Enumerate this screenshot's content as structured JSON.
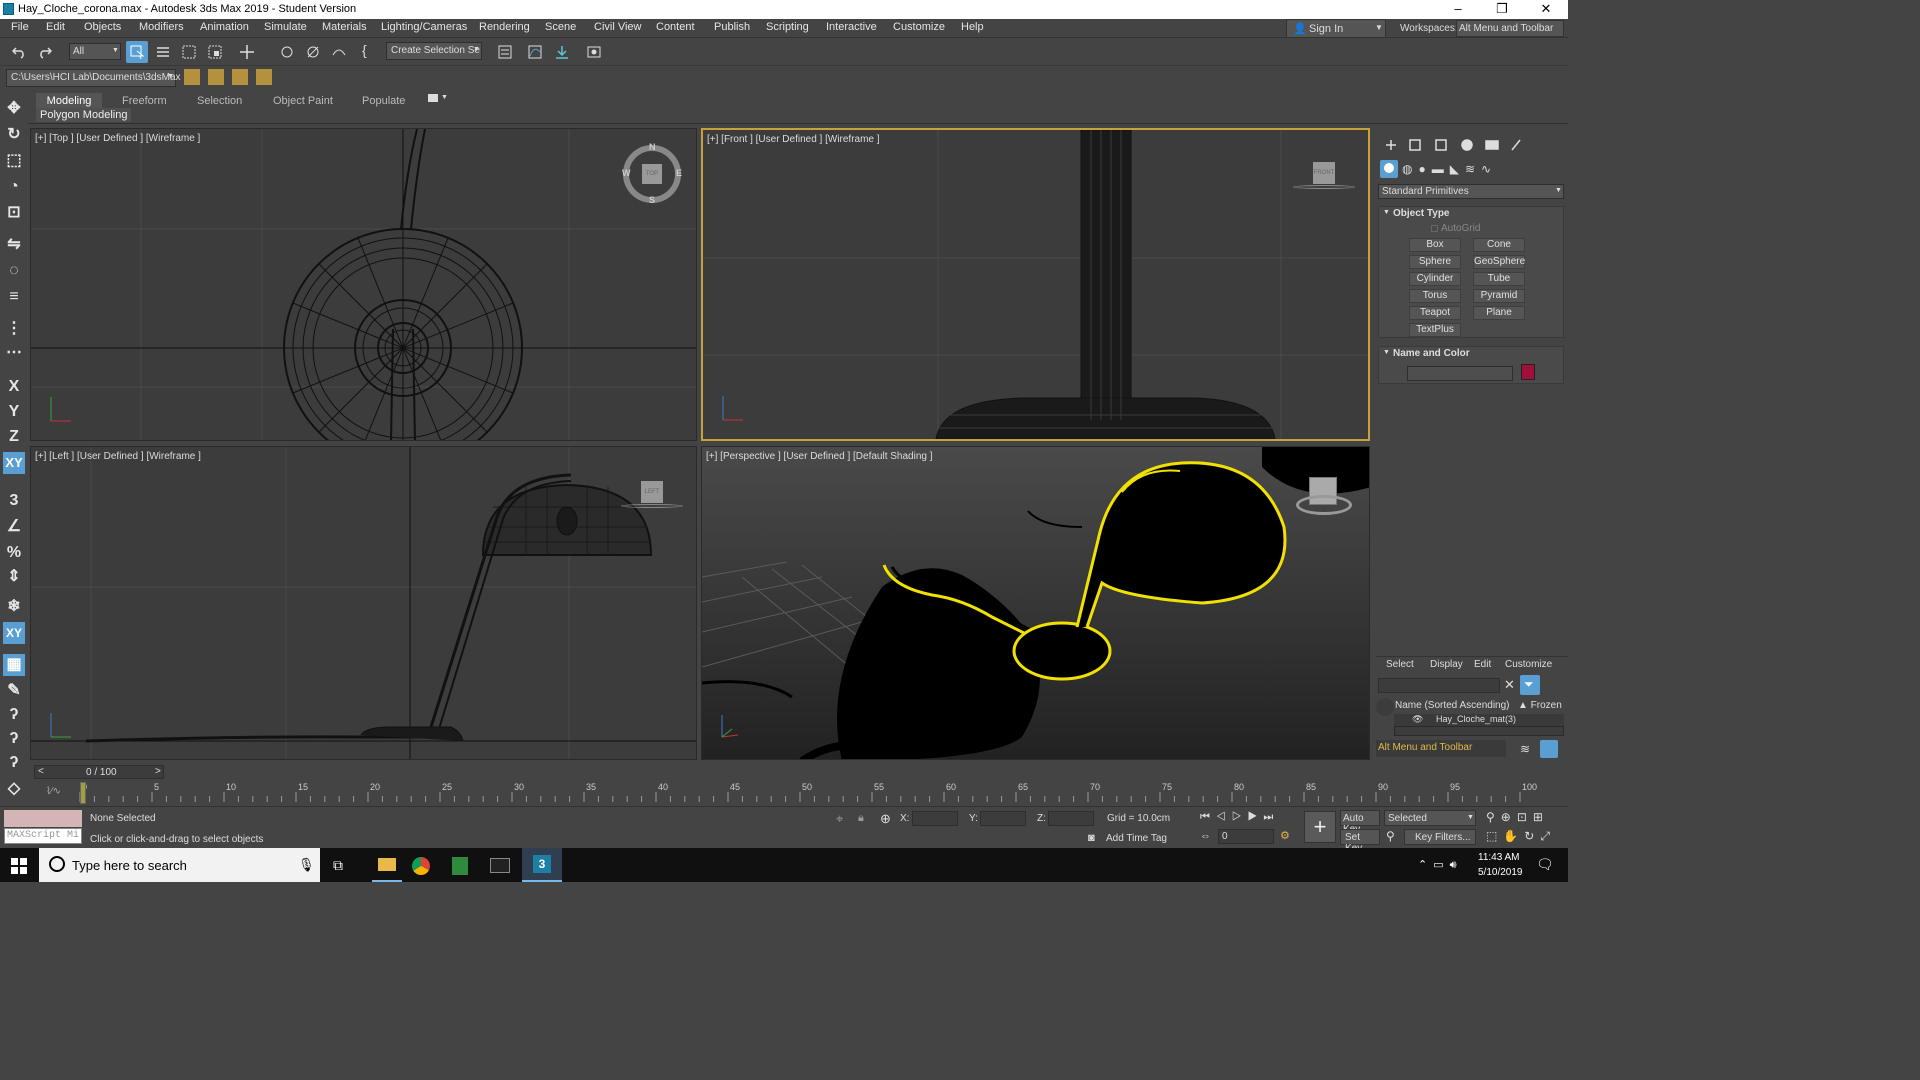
{
  "window": {
    "title": "Hay_Cloche_corona.max - Autodesk 3ds Max 2019 - Student Version",
    "controls": [
      "–",
      "❐",
      "✕"
    ]
  },
  "menu": [
    "File",
    "Edit",
    "Objects",
    "Modifiers",
    "Animation",
    "Simulate",
    "Materials",
    "Lighting/Cameras",
    "Rendering",
    "Scene",
    "Civil View",
    "Content",
    "Publish",
    "Scripting",
    "Interactive",
    "Customize",
    "Help"
  ],
  "account": {
    "sign_in": "Sign In",
    "workspaces_label": "Workspaces:",
    "workspace": "Alt Menu and Toolbar"
  },
  "toolbar": {
    "filter": "All",
    "selection_set": "Create Selection Se"
  },
  "path": "C:\\Users\\HCI Lab\\Documents\\3dsMax",
  "ribbon": {
    "tabs": [
      "Modeling",
      "Freeform",
      "Selection",
      "Object Paint",
      "Populate"
    ],
    "active_tab": "Modeling",
    "panel": "Polygon Modeling"
  },
  "axis_buttons": [
    "X",
    "Y",
    "Z",
    "XY"
  ],
  "viewports": {
    "top": {
      "label": "[+] [Top ] [User Defined ] [Wireframe ]",
      "compass": [
        "N",
        "E",
        "S",
        "W"
      ],
      "cube": "TOP"
    },
    "front": {
      "label": "[+] [Front ] [User Defined ] [Wireframe ]",
      "cube": "FRONT"
    },
    "left": {
      "label": "[+] [Left ] [User Defined ] [Wireframe ]",
      "cube": "LEFT"
    },
    "persp": {
      "label": "[+] [Perspective ] [User Defined ] [Default Shading ]"
    }
  },
  "command_panel": {
    "category": "Standard Primitives",
    "rollout_object_type": "Object Type",
    "autogrid": "AutoGrid",
    "primitives": [
      "Box",
      "Cone",
      "Sphere",
      "GeoSphere",
      "Cylinder",
      "Tube",
      "Torus",
      "Pyramid",
      "Teapot",
      "Plane",
      "TextPlus"
    ],
    "rollout_name_color": "Name and Color",
    "swatch_color": "#a0103a"
  },
  "scene_explorer": {
    "tabs": [
      "Select",
      "Display",
      "Edit",
      "Customize"
    ],
    "column": "Name (Sorted Ascending)",
    "frozen": "▲ Frozen",
    "item": "Hay_Cloche_mat(3)",
    "workspace": "Alt Menu and Toolbar"
  },
  "timeline": {
    "frame": "0 / 100",
    "ticks": [
      "0",
      "5",
      "10",
      "15",
      "20",
      "25",
      "30",
      "35",
      "40",
      "45",
      "50",
      "55",
      "60",
      "65",
      "70",
      "75",
      "80",
      "85",
      "90",
      "95",
      "100"
    ]
  },
  "status": {
    "selection": "None Selected",
    "prompt": "Click or click-and-drag to select objects",
    "maxscript": "MAXScript Mi",
    "x_label": "X:",
    "y_label": "Y:",
    "z_label": "Z:",
    "grid": "Grid = 10.0cm",
    "add_time_tag": "Add Time Tag",
    "auto_key": "Auto Key",
    "set_key": "Set Key",
    "key_mode": "Selected",
    "key_filters": "Key Filters...",
    "frame_value": "0"
  },
  "taskbar": {
    "search_placeholder": "Type here to search",
    "time": "11:43 AM",
    "date": "5/10/2019"
  },
  "colors": {
    "selection_highlight": "#f0e100",
    "active_viewport_border": "#c8a03c",
    "accent_blue": "#5a9fd4"
  }
}
